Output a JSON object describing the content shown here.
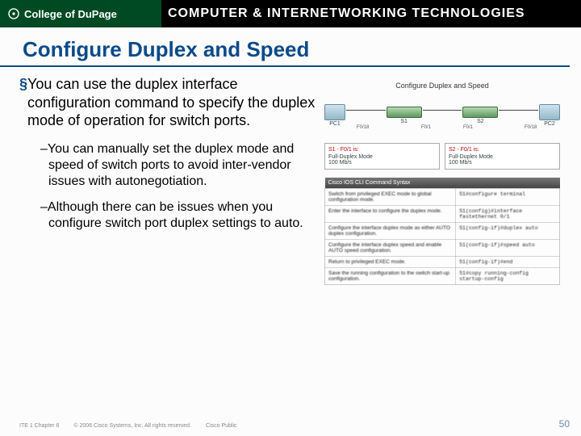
{
  "header": {
    "college": "College of DuPage",
    "program": "COMPUTER & INTERNETWORKING TECHNOLOGIES"
  },
  "title": "Configure Duplex and Speed",
  "bullets": {
    "main": "You can use the duplex interface configuration command to specify the duplex mode of operation for switch ports.",
    "sub1": "You can manually set the duplex mode and speed of switch ports to avoid inter-vendor issues with autonegotiation.",
    "sub2": "Although there can be issues when you configure switch port duplex settings to auto."
  },
  "diagram": {
    "title": "Configure Duplex and Speed",
    "nodes": {
      "pc1": "PC1",
      "s1": "S1",
      "s2": "S2",
      "pc2": "PC2"
    },
    "ports": {
      "p1": "F0/18",
      "p2": "F0/1",
      "p3": "F0/1",
      "p4": "F0/18"
    },
    "box1": {
      "hd": "S1 - F0/1 is:",
      "l1": "Full-Duplex Mode",
      "l2": "100 Mb/s"
    },
    "box2": {
      "hd": "S2 - F0/1 is:",
      "l1": "Full-Duplex Mode",
      "l2": "100 Mb/s"
    }
  },
  "table": {
    "header": "Cisco IOS CLI Command Syntax",
    "rows": [
      {
        "desc": "Switch from privileged EXEC mode to global configuration mode.",
        "cmd": "S1#configure terminal"
      },
      {
        "desc": "Enter the interface to configure the duplex mode.",
        "cmd": "S1(config)#interface fastethernet 0/1"
      },
      {
        "desc": "Configure the interface duplex mode as either AUTO duplex configuration.",
        "cmd": "S1(config-if)#duplex auto"
      },
      {
        "desc": "Configure the interface duplex speed and enable AUTO speed configuration.",
        "cmd": "S1(config-if)#speed auto"
      },
      {
        "desc": "Return to privileged EXEC mode.",
        "cmd": "S1(config-if)#end"
      },
      {
        "desc": "Save the running configuration to the switch start-up configuration.",
        "cmd": "S1#copy running-config startup-config"
      }
    ]
  },
  "footer": {
    "left1": "ITE 1 Chapter 6",
    "left2": "© 2006 Cisco Systems, Inc. All rights reserved.",
    "left3": "Cisco Public",
    "page": "50"
  }
}
